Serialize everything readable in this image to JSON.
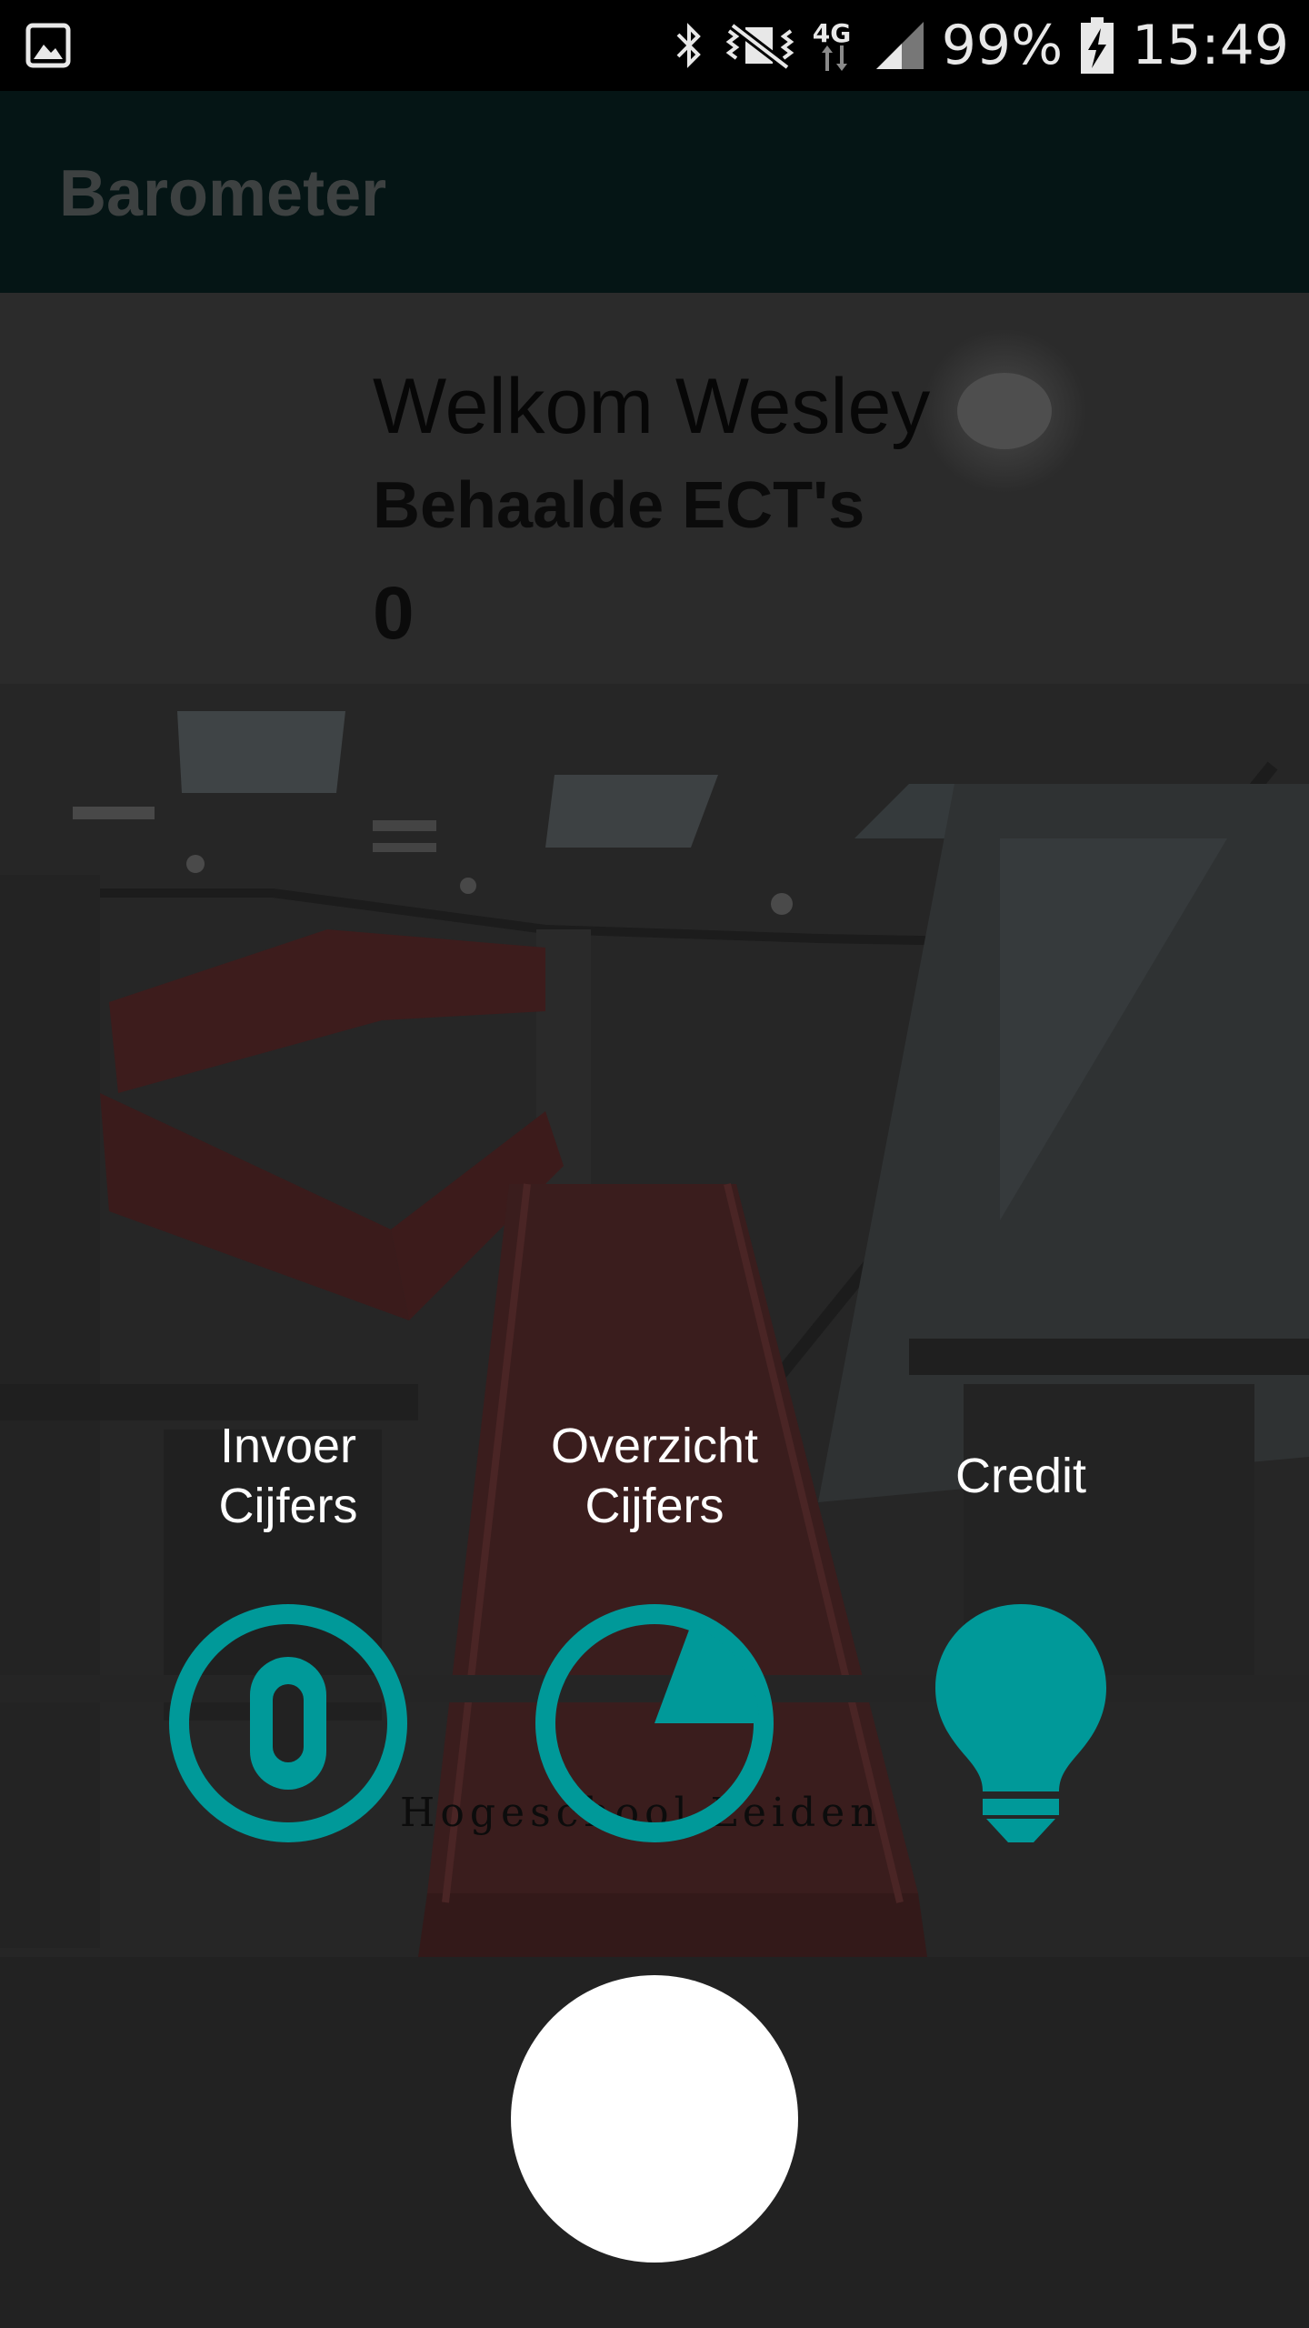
{
  "status_bar": {
    "battery_percent": "99%",
    "time": "15:49",
    "network": "4G",
    "icons": [
      "gallery-notification-icon",
      "bluetooth-icon",
      "vibrate-mute-icon",
      "network-4g-icon",
      "signal-icon",
      "battery-charging-icon"
    ]
  },
  "app_bar": {
    "title": "Barometer"
  },
  "header": {
    "welcome": "Welkom Wesley",
    "ects_label": "Behaalde ECT's",
    "ects_value": "0"
  },
  "watermark": "Hogeschool Leiden",
  "menu": [
    {
      "label": "Invoer\nCijfers",
      "icon": "input-zero-icon"
    },
    {
      "label": "Overzicht\nCijfers",
      "icon": "pie-progress-icon"
    },
    {
      "label": "Credit",
      "icon": "lightbulb-icon"
    }
  ],
  "colors": {
    "accent": "#009999",
    "status_bar": "#000000",
    "app_bar": "#051515",
    "fab": "#ffffff"
  }
}
